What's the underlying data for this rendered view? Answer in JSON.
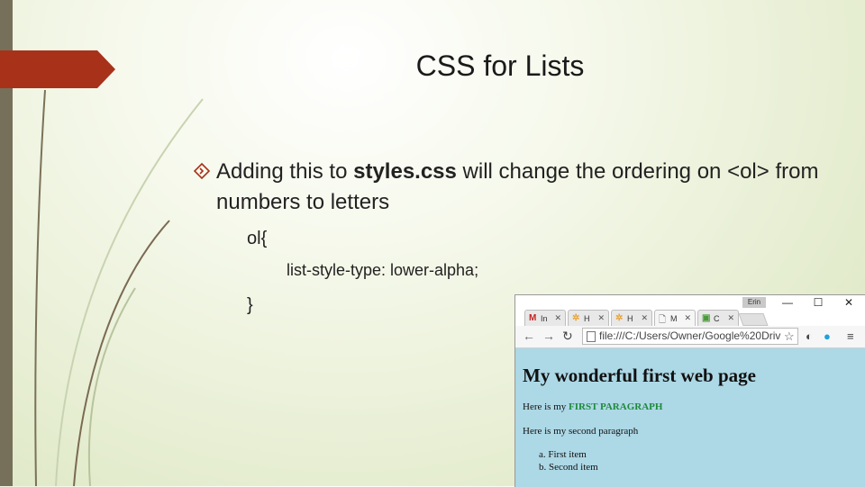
{
  "slide": {
    "title": "CSS for Lists",
    "bullet": {
      "text_before": "Adding this to ",
      "bold": "styles.css",
      "text_after": " will change the ordering on <ol> from numbers to letters"
    },
    "code": {
      "line1": "ol{",
      "line2": "list-style-type: lower-alpha;",
      "line3": "}"
    },
    "colors": {
      "accent_tab": "#a8311a",
      "left_bar": "#76705a",
      "browser_bg": "#add8e6"
    }
  },
  "browser": {
    "profile_chip": "Erin",
    "window_buttons": {
      "minimize": "—",
      "maximize": "☐",
      "close": "✕"
    },
    "tabs": [
      {
        "icon": "M",
        "label": "In"
      },
      {
        "icon": "✲",
        "label": "H"
      },
      {
        "icon": "✲",
        "label": "H"
      },
      {
        "icon": "🗋",
        "label": "M"
      },
      {
        "icon": "▣",
        "label": "C"
      }
    ],
    "url": "file:///C:/Users/Owner/Google%20Driv",
    "page": {
      "heading": "My wonderful first web page",
      "para1_prefix": "Here is my ",
      "para1_highlight": "FIRST PARAGRAPH",
      "para2": "Here is my second paragraph",
      "list_items": [
        "a. First item",
        "b. Second item"
      ]
    }
  }
}
